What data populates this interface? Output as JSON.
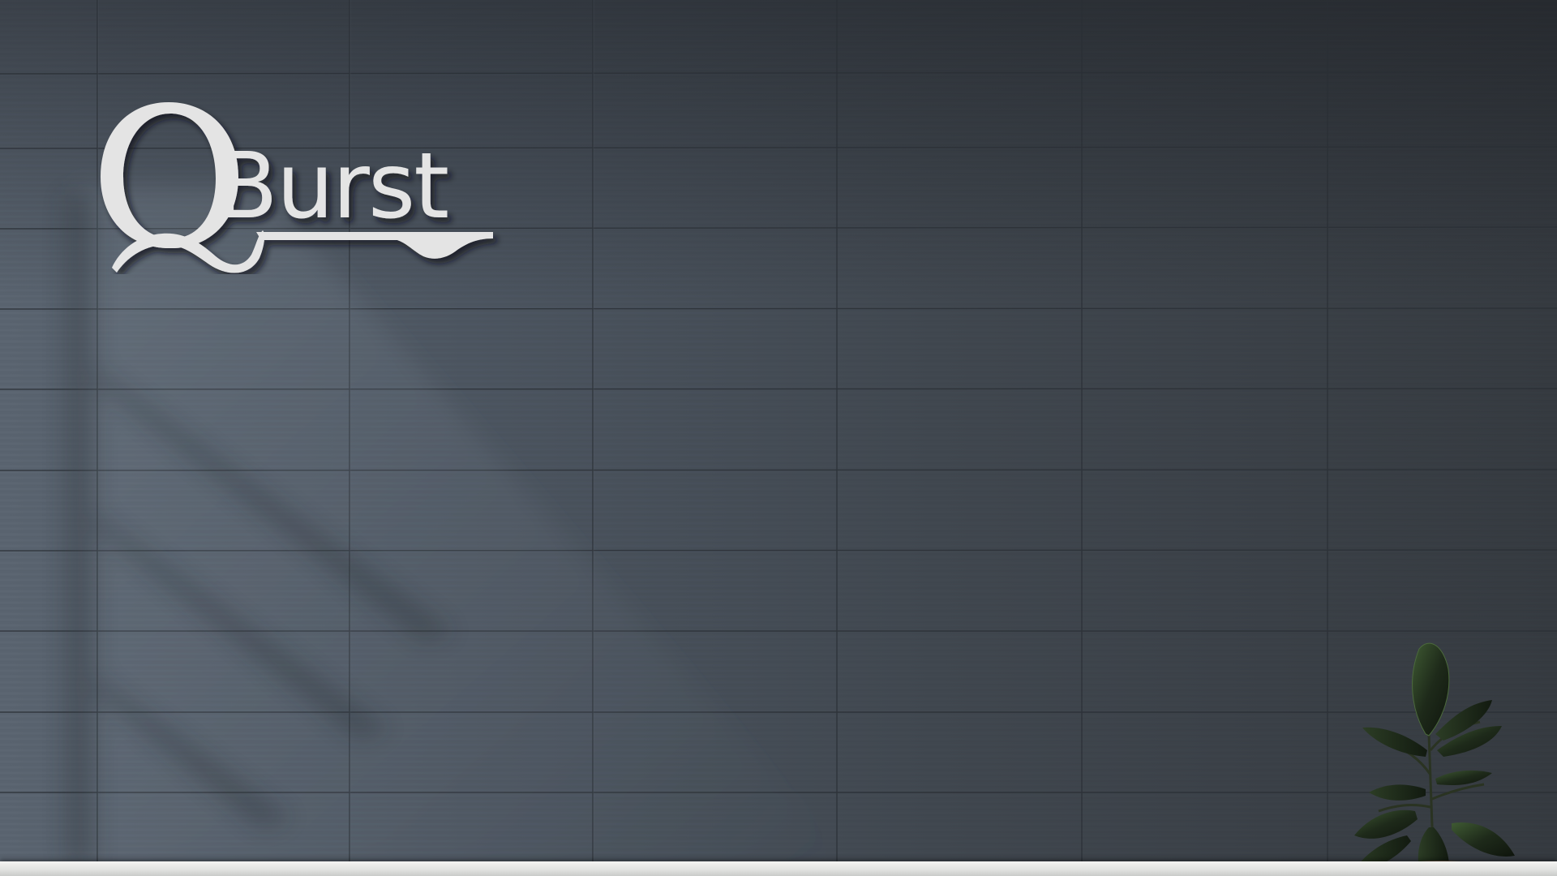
{
  "logo": {
    "text": "QBurst",
    "color": "#e4e4e4"
  },
  "colors": {
    "wall": "#454c55",
    "ledge": "#ecedeb",
    "leaf": "#1f2a1c"
  }
}
